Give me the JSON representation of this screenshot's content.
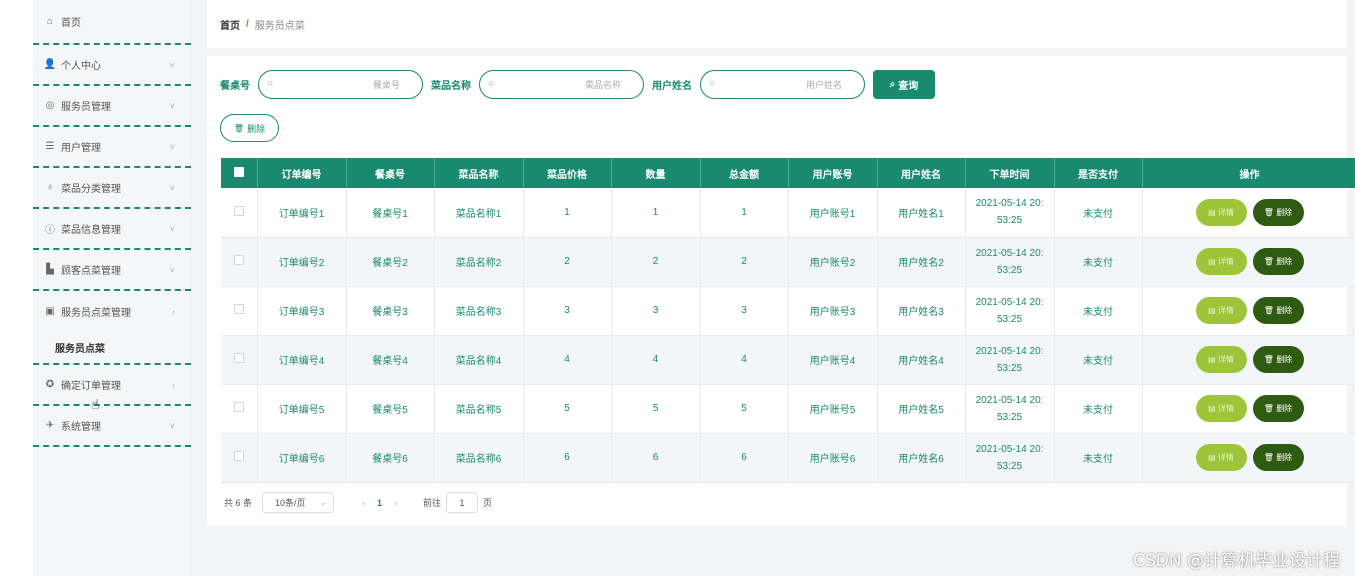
{
  "sidebar": {
    "items": [
      {
        "label": "首页",
        "icon": "home-icon",
        "glyph": "⌂"
      },
      {
        "label": "个人中心",
        "icon": "user-icon",
        "glyph": "👤"
      },
      {
        "label": "服务员管理",
        "icon": "group-icon",
        "glyph": "◎"
      },
      {
        "label": "用户管理",
        "icon": "list-icon",
        "glyph": "☰"
      },
      {
        "label": "菜品分类管理",
        "icon": "mic-icon",
        "glyph": "♁"
      },
      {
        "label": "菜品信息管理",
        "icon": "bulb-icon",
        "glyph": "ⓘ"
      },
      {
        "label": "顾客点菜管理",
        "icon": "chart-icon",
        "glyph": "▙"
      },
      {
        "label": "服务员点菜管理",
        "icon": "case-icon",
        "glyph": "▣"
      },
      {
        "label": "确定订单管理",
        "icon": "compass-icon",
        "glyph": "✪"
      },
      {
        "label": "系统管理",
        "icon": "plane-icon",
        "glyph": "✈"
      }
    ],
    "sub_item": "服务员点菜",
    "chevrons": [
      "˅",
      "˅",
      "˅",
      "˅",
      "˅",
      "˅",
      "‹",
      "‹",
      "˅"
    ]
  },
  "breadcrumb": {
    "home": "首页",
    "sep": "/",
    "current": "服务员点菜"
  },
  "search": {
    "table_no_label": "餐桌号",
    "table_no_placeholder": "餐桌号",
    "dish_label": "菜品名称",
    "dish_placeholder": "菜品名称",
    "user_label": "用户姓名",
    "user_placeholder": "用户姓名",
    "query_button": "查询",
    "query_icon": "⌕"
  },
  "toolbar": {
    "delete_label": "删除",
    "delete_icon": "🗑"
  },
  "table": {
    "headers": [
      "订单编号",
      "餐桌号",
      "菜品名称",
      "菜品价格",
      "数量",
      "总金额",
      "用户账号",
      "用户姓名",
      "下单时间",
      "是否支付",
      "操作"
    ],
    "rows": [
      {
        "order": "订单编号1",
        "table": "餐桌号1",
        "dish": "菜品名称1",
        "price": "1",
        "qty": "1",
        "total": "1",
        "account": "用户账号1",
        "name": "用户姓名1",
        "time1": "2021-05-14 20:",
        "time2": "53:25",
        "paid": "未支付"
      },
      {
        "order": "订单编号2",
        "table": "餐桌号2",
        "dish": "菜品名称2",
        "price": "2",
        "qty": "2",
        "total": "2",
        "account": "用户账号2",
        "name": "用户姓名2",
        "time1": "2021-05-14 20:",
        "time2": "53:25",
        "paid": "未支付"
      },
      {
        "order": "订单编号3",
        "table": "餐桌号3",
        "dish": "菜品名称3",
        "price": "3",
        "qty": "3",
        "total": "3",
        "account": "用户账号3",
        "name": "用户姓名3",
        "time1": "2021-05-14 20:",
        "time2": "53:25",
        "paid": "未支付"
      },
      {
        "order": "订单编号4",
        "table": "餐桌号4",
        "dish": "菜品名称4",
        "price": "4",
        "qty": "4",
        "total": "4",
        "account": "用户账号4",
        "name": "用户姓名4",
        "time1": "2021-05-14 20:",
        "time2": "53:25",
        "paid": "未支付"
      },
      {
        "order": "订单编号5",
        "table": "餐桌号5",
        "dish": "菜品名称5",
        "price": "5",
        "qty": "5",
        "total": "5",
        "account": "用户账号5",
        "name": "用户姓名5",
        "time1": "2021-05-14 20:",
        "time2": "53:25",
        "paid": "未支付"
      },
      {
        "order": "订单编号6",
        "table": "餐桌号6",
        "dish": "菜品名称6",
        "price": "6",
        "qty": "6",
        "total": "6",
        "account": "用户账号6",
        "name": "用户姓名6",
        "time1": "2021-05-14 20:",
        "time2": "53:25",
        "paid": "未支付"
      }
    ],
    "detail_label": "详情",
    "detail_icon": "▤",
    "row_delete_label": "删除",
    "row_delete_icon": "🗑"
  },
  "pagination": {
    "total": "共 6 条",
    "page_size": "10条/页",
    "prev": "‹",
    "page": "1",
    "next": "›",
    "goto_label": "前往",
    "goto_value": "1",
    "page_suffix": "页"
  },
  "watermark": "CSDN @计算机毕业设计程",
  "colors": {
    "accent": "#1a8a6e",
    "detail": "#9ec43a",
    "delete": "#2f5a12"
  }
}
